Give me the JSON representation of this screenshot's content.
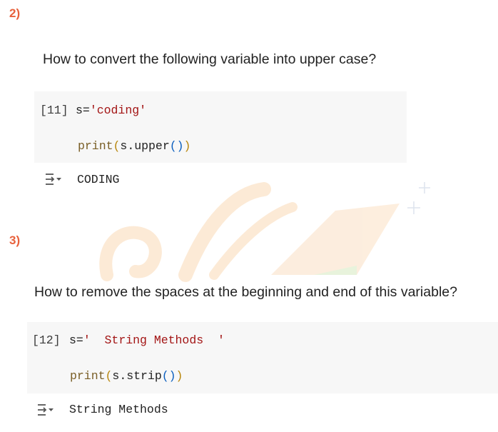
{
  "q2": {
    "number": "2)",
    "question": "How to convert the following variable into upper case?",
    "cell": {
      "prompt": "[11]",
      "line1_prefix": "s=",
      "line1_string": "'coding'",
      "line2_fn": "print",
      "line2_open": "(",
      "line2_middle": "s.upper",
      "line2_call": "()",
      "line2_close": ")"
    },
    "output": "CODING"
  },
  "q3": {
    "number": "3)",
    "question": "How to remove the spaces at the beginning and end of this variable?",
    "cell": {
      "prompt": "[12]",
      "line1_prefix": "s=",
      "line1_string": "'  String Methods  '",
      "line2_fn": "print",
      "line2_open": "(",
      "line2_middle": "s.strip",
      "line2_call": "()",
      "line2_close": ")"
    },
    "output": "String Methods"
  },
  "icons": {
    "output_toggle": "output-toggle-icon",
    "watermark": "watermark-logo"
  },
  "colors": {
    "question_number": "#e8613c",
    "cell_background": "#f7f7f7",
    "string_literal": "#a31515"
  }
}
